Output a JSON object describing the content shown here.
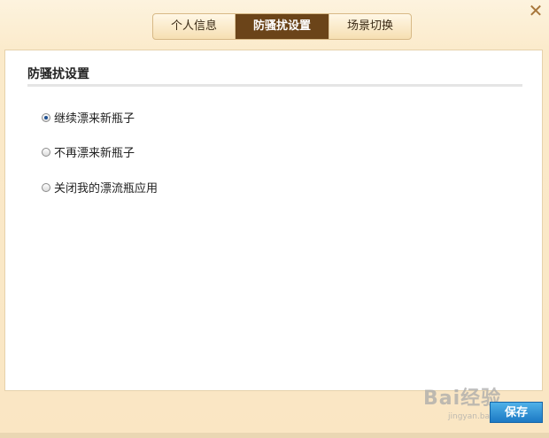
{
  "dialog": {
    "close_icon": "close-x-icon"
  },
  "tabs": [
    {
      "label": "个人信息",
      "active": false
    },
    {
      "label": "防骚扰设置",
      "active": true
    },
    {
      "label": "场景切换",
      "active": false
    }
  ],
  "section": {
    "title": "防骚扰设置"
  },
  "options": [
    {
      "label": "继续漂来新瓶子",
      "checked": true
    },
    {
      "label": "不再漂来新瓶子",
      "checked": false
    },
    {
      "label": "关闭我的漂流瓶应用",
      "checked": false
    }
  ],
  "footer": {
    "save_label": "保存"
  },
  "watermark": {
    "brand": "Bai经验",
    "url": "jingyan.baidu.com"
  },
  "colors": {
    "active_tab": "#6b4419",
    "save_button": "#1c79c4",
    "background": "#fbeaca"
  }
}
